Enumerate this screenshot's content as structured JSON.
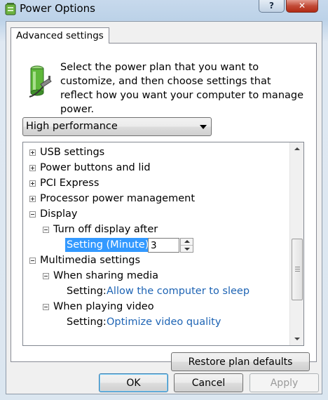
{
  "window": {
    "title": "Power Options",
    "help_label": "?",
    "close_label": "✕"
  },
  "tabs": [
    {
      "label": "Advanced settings"
    }
  ],
  "description": "Select the power plan that you want to customize, and then choose settings that reflect how you want your computer to manage power.",
  "plan_select": {
    "value": "High performance"
  },
  "tree": {
    "items": [
      {
        "label": "USB settings",
        "expander": "plus"
      },
      {
        "label": "Power buttons and lid",
        "expander": "plus"
      },
      {
        "label": "PCI Express",
        "expander": "plus"
      },
      {
        "label": "Processor power management",
        "expander": "plus"
      },
      {
        "label": "Display",
        "expander": "minus"
      },
      {
        "label": "Turn off display after",
        "expander": "minus"
      },
      {
        "label": "Multimedia settings",
        "expander": "minus"
      },
      {
        "label": "When sharing media",
        "expander": "minus"
      },
      {
        "label": "When playing video",
        "expander": "minus"
      }
    ],
    "display_setting": {
      "label": "Setting (Minute):",
      "value": "3"
    },
    "sharing_setting": {
      "label": "Setting:",
      "value": "Allow the computer to sleep"
    },
    "video_setting": {
      "label": "Setting:",
      "value": "Optimize video quality"
    }
  },
  "buttons": {
    "restore": "Restore plan defaults",
    "ok": "OK",
    "cancel": "Cancel",
    "apply": "Apply"
  },
  "icons": {
    "app": "power-options-icon",
    "header": "battery-plug-icon",
    "expand": "plus-icon",
    "collapse": "minus-icon"
  },
  "colors": {
    "selection": "#3399ff",
    "link": "#1e64b4",
    "close_button": "#c24b37"
  }
}
